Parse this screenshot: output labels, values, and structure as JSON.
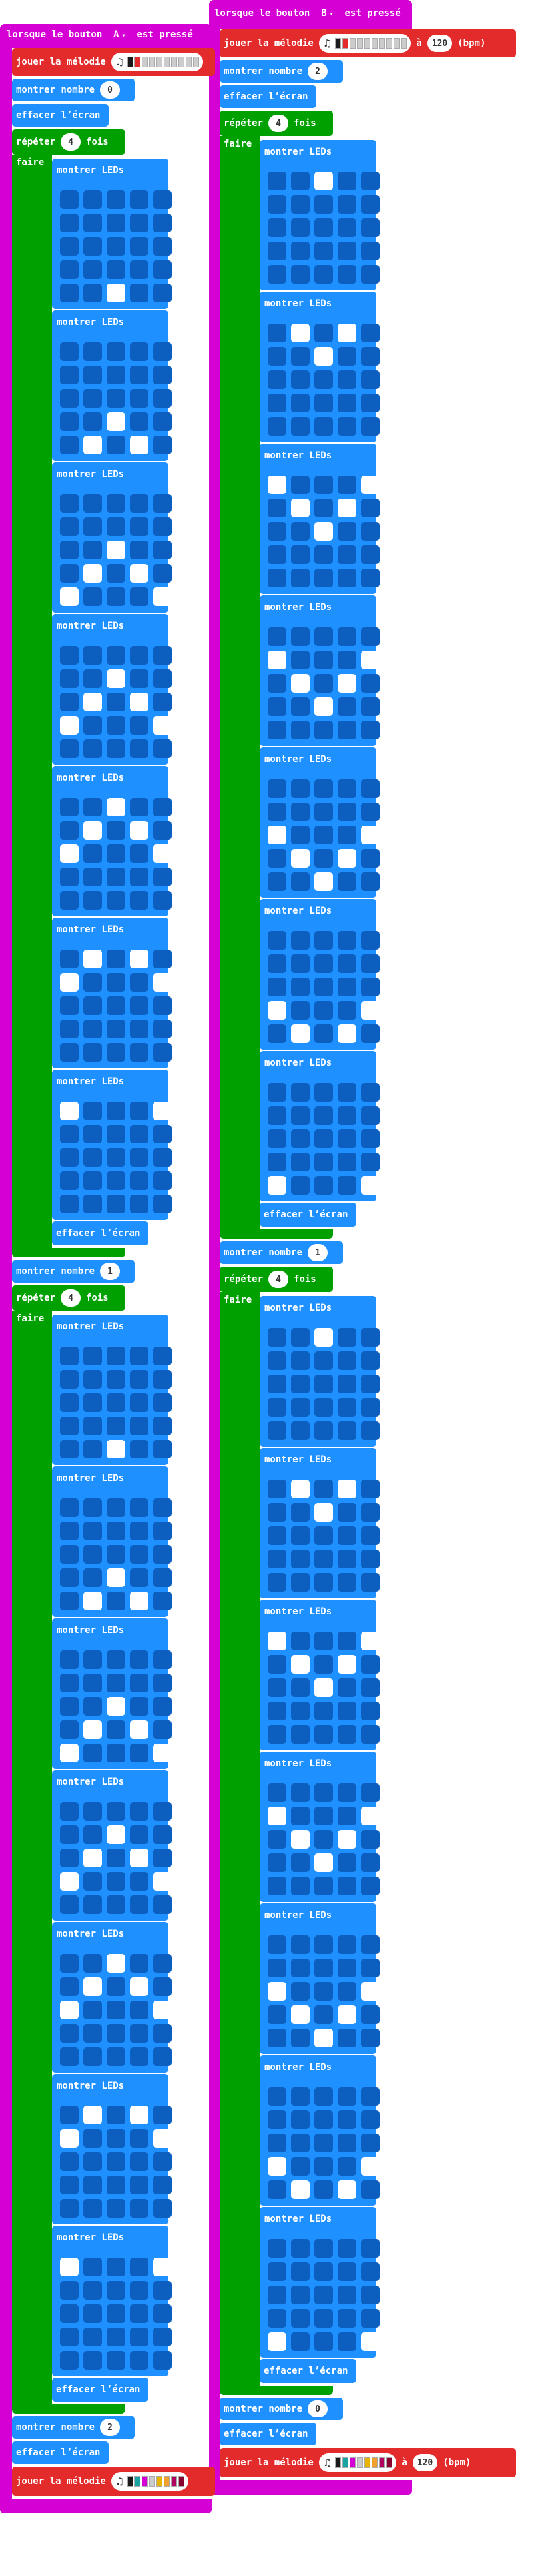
{
  "colors": {
    "hat": "#d400d4",
    "melody": "#e32b2b",
    "basic": "#1e90ff",
    "loop": "#00a000",
    "led_off": "#0d5fbf",
    "led_on": "#ffffff"
  },
  "labels": {
    "show_leds": "montrer LEDs",
    "clear_screen": "effacer l’écran",
    "show_number": "montrer nombre",
    "play_melody": "jouer la mélodie",
    "at": "à",
    "bpm": "(bpm)",
    "repeat": "répéter",
    "times": "fois",
    "do": "faire",
    "when": "lorsque le bouton",
    "pressed": "est pressé"
  },
  "scripts": [
    {
      "button": "A",
      "melody_top": {
        "notes": [
          "#1a1a1a",
          "#e32b2b",
          "#cccccc",
          "#cccccc",
          "#cccccc",
          "#cccccc",
          "#cccccc",
          "#cccccc",
          "#cccccc",
          "#cccccc"
        ]
      },
      "numbers": [
        "0",
        "1",
        "2"
      ],
      "repeat_times": [
        "4",
        "4"
      ],
      "melody_bottom": {
        "notes": [
          "#1a1a1a",
          "#1aa3a3",
          "#d400d4",
          "#cccccc",
          "#e8b400",
          "#f0a030",
          "#b00060",
          "#8a0030"
        ]
      },
      "frames": [
        [
          [
            0,
            0,
            0,
            0,
            0
          ],
          [
            0,
            0,
            0,
            0,
            0
          ],
          [
            0,
            0,
            0,
            0,
            0
          ],
          [
            0,
            0,
            0,
            0,
            0
          ],
          [
            0,
            0,
            1,
            0,
            0
          ]
        ],
        [
          [
            0,
            0,
            0,
            0,
            0
          ],
          [
            0,
            0,
            0,
            0,
            0
          ],
          [
            0,
            0,
            0,
            0,
            0
          ],
          [
            0,
            0,
            1,
            0,
            0
          ],
          [
            0,
            1,
            0,
            1,
            0
          ]
        ],
        [
          [
            0,
            0,
            0,
            0,
            0
          ],
          [
            0,
            0,
            0,
            0,
            0
          ],
          [
            0,
            0,
            1,
            0,
            0
          ],
          [
            0,
            1,
            0,
            1,
            0
          ],
          [
            1,
            0,
            0,
            0,
            1
          ]
        ],
        [
          [
            0,
            0,
            0,
            0,
            0
          ],
          [
            0,
            0,
            1,
            0,
            0
          ],
          [
            0,
            1,
            0,
            1,
            0
          ],
          [
            1,
            0,
            0,
            0,
            1
          ],
          [
            0,
            0,
            0,
            0,
            0
          ]
        ],
        [
          [
            0,
            0,
            1,
            0,
            0
          ],
          [
            0,
            1,
            0,
            1,
            0
          ],
          [
            1,
            0,
            0,
            0,
            1
          ],
          [
            0,
            0,
            0,
            0,
            0
          ],
          [
            0,
            0,
            0,
            0,
            0
          ]
        ],
        [
          [
            0,
            1,
            0,
            1,
            0
          ],
          [
            1,
            0,
            0,
            0,
            1
          ],
          [
            0,
            0,
            0,
            0,
            0
          ],
          [
            0,
            0,
            0,
            0,
            0
          ],
          [
            0,
            0,
            0,
            0,
            0
          ]
        ],
        [
          [
            1,
            0,
            0,
            0,
            1
          ],
          [
            0,
            0,
            0,
            0,
            0
          ],
          [
            0,
            0,
            0,
            0,
            0
          ],
          [
            0,
            0,
            0,
            0,
            0
          ],
          [
            0,
            0,
            0,
            0,
            0
          ]
        ]
      ]
    },
    {
      "button": "B",
      "melody_top": {
        "notes": [
          "#1a1a1a",
          "#e32b2b",
          "#cccccc",
          "#cccccc",
          "#cccccc",
          "#cccccc",
          "#cccccc",
          "#cccccc",
          "#cccccc",
          "#cccccc"
        ]
      },
      "tempo_top": "120",
      "numbers": [
        "2",
        "1",
        "0"
      ],
      "repeat_times": [
        "4",
        "4"
      ],
      "melody_bottom": {
        "notes": [
          "#1a1a1a",
          "#1aa3a3",
          "#d400d4",
          "#cccccc",
          "#e8b400",
          "#f0a030",
          "#b00060",
          "#8a0030"
        ]
      },
      "tempo_bottom": "120",
      "frames": [
        [
          [
            0,
            0,
            1,
            0,
            0
          ],
          [
            0,
            0,
            0,
            0,
            0
          ],
          [
            0,
            0,
            0,
            0,
            0
          ],
          [
            0,
            0,
            0,
            0,
            0
          ],
          [
            0,
            0,
            0,
            0,
            0
          ]
        ],
        [
          [
            0,
            1,
            0,
            1,
            0
          ],
          [
            0,
            0,
            1,
            0,
            0
          ],
          [
            0,
            0,
            0,
            0,
            0
          ],
          [
            0,
            0,
            0,
            0,
            0
          ],
          [
            0,
            0,
            0,
            0,
            0
          ]
        ],
        [
          [
            1,
            0,
            0,
            0,
            1
          ],
          [
            0,
            1,
            0,
            1,
            0
          ],
          [
            0,
            0,
            1,
            0,
            0
          ],
          [
            0,
            0,
            0,
            0,
            0
          ],
          [
            0,
            0,
            0,
            0,
            0
          ]
        ],
        [
          [
            0,
            0,
            0,
            0,
            0
          ],
          [
            1,
            0,
            0,
            0,
            1
          ],
          [
            0,
            1,
            0,
            1,
            0
          ],
          [
            0,
            0,
            1,
            0,
            0
          ],
          [
            0,
            0,
            0,
            0,
            0
          ]
        ],
        [
          [
            0,
            0,
            0,
            0,
            0
          ],
          [
            0,
            0,
            0,
            0,
            0
          ],
          [
            1,
            0,
            0,
            0,
            1
          ],
          [
            0,
            1,
            0,
            1,
            0
          ],
          [
            0,
            0,
            1,
            0,
            0
          ]
        ],
        [
          [
            0,
            0,
            0,
            0,
            0
          ],
          [
            0,
            0,
            0,
            0,
            0
          ],
          [
            0,
            0,
            0,
            0,
            0
          ],
          [
            1,
            0,
            0,
            0,
            1
          ],
          [
            0,
            1,
            0,
            1,
            0
          ]
        ],
        [
          [
            0,
            0,
            0,
            0,
            0
          ],
          [
            0,
            0,
            0,
            0,
            0
          ],
          [
            0,
            0,
            0,
            0,
            0
          ],
          [
            0,
            0,
            0,
            0,
            0
          ],
          [
            1,
            0,
            0,
            0,
            1
          ]
        ]
      ]
    }
  ]
}
